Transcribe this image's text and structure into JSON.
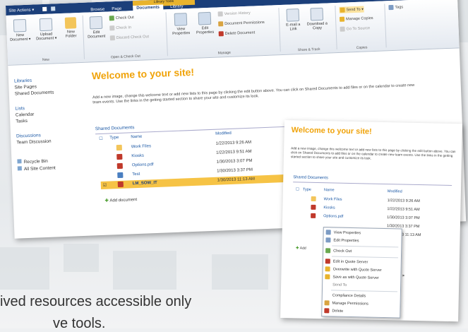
{
  "ribbon": {
    "site_actions": "Site Actions ▾",
    "tabs": [
      "Browse",
      "Page",
      "Documents",
      "Library"
    ],
    "context_group": "Library Tools",
    "buttons": {
      "new_document": "New Document ▾",
      "upload_document": "Upload Document ▾",
      "new_folder": "New Folder",
      "edit_document": "Edit Document",
      "check_out": "Check Out",
      "check_in": "Check In",
      "discard_check_out": "Discard Check Out",
      "view_properties": "View Properties",
      "edit_properties": "Edit Properties",
      "version_history": "Version History",
      "document_permissions": "Document Permissions",
      "delete_document": "Delete Document",
      "email_link": "E-mail a Link",
      "download_copy": "Download a Copy",
      "send_to": "Send To ▾",
      "manage_copies": "Manage Copies",
      "go_to_source": "Go To Source",
      "tags": "Tags"
    },
    "groups": [
      "New",
      "Open & Check Out",
      "Manage",
      "Share & Track",
      "Copies"
    ]
  },
  "nav": {
    "sections": [
      {
        "heading": "Libraries",
        "items": [
          "Site Pages",
          "Shared Documents"
        ]
      },
      {
        "heading": "Lists",
        "items": [
          "Calendar",
          "Tasks"
        ]
      },
      {
        "heading": "Discussions",
        "items": [
          "Team Discussion"
        ]
      }
    ],
    "recycle_bin": "Recycle Bin",
    "all_site_content": "All Site Content"
  },
  "main": {
    "welcome": "Welcome to your site!",
    "intro": "Add a new image, change this welcome text or add new lists to this page by clicking the edit button above. You can click on Shared Documents to add files or on the calendar to create new team events. Use the links in the getting started section to share your site and customize its look.",
    "doc_title": "Shared Documents",
    "columns": [
      "Type",
      "Name",
      "Modified"
    ],
    "rows": [
      {
        "name": "Work Files",
        "modified": "1/22/2013 9:26 AM"
      },
      {
        "name": "Kiosks",
        "modified": "1/22/2013 9:51 AM"
      },
      {
        "name": "Options.pdf",
        "modified": "1/30/2013 3:07 PM"
      },
      {
        "name": "Test",
        "modified": "1/30/2013 3:37 PM"
      },
      {
        "name": "LM_SOW_IT",
        "modified": "1/30/2013 11:13 AM"
      }
    ],
    "add_document": "Add document"
  },
  "zoom": {
    "welcome": "Welcome to your site!",
    "intro": "Add a new image, change this welcome text or add new lists to this page by clicking the edit button above. You can click on Shared Documents to add files or on the calendar to create new team events. Use the links in the getting started section to share your site and customize its look.",
    "doc_title": "Shared Documents",
    "columns": [
      "Type",
      "Name",
      "Modified"
    ],
    "rows": [
      {
        "name": "Work Files",
        "modified": "1/22/2013 9:26 AM"
      },
      {
        "name": "Kiosks",
        "modified": "1/22/2013 9:51 AM"
      },
      {
        "name": "Options.pdf",
        "modified": "1/30/2013 3:07 PM"
      },
      {
        "name": "",
        "modified": "1/30/2013 3:37 PM"
      },
      {
        "name": "",
        "modified": "1/30/2013 11:13 AM"
      }
    ],
    "add": "Add",
    "menu": [
      "View Properties",
      "Edit Properties",
      "Check Out",
      "Edit in Quote Server",
      "Overwrite with Quote Server",
      "Save as with Quote Server",
      "Send To",
      "Compliance Details",
      "Manage Permissions",
      "Delete"
    ]
  },
  "tagline": {
    "line1": "ived resources accessible only",
    "line2": "ve tools."
  }
}
